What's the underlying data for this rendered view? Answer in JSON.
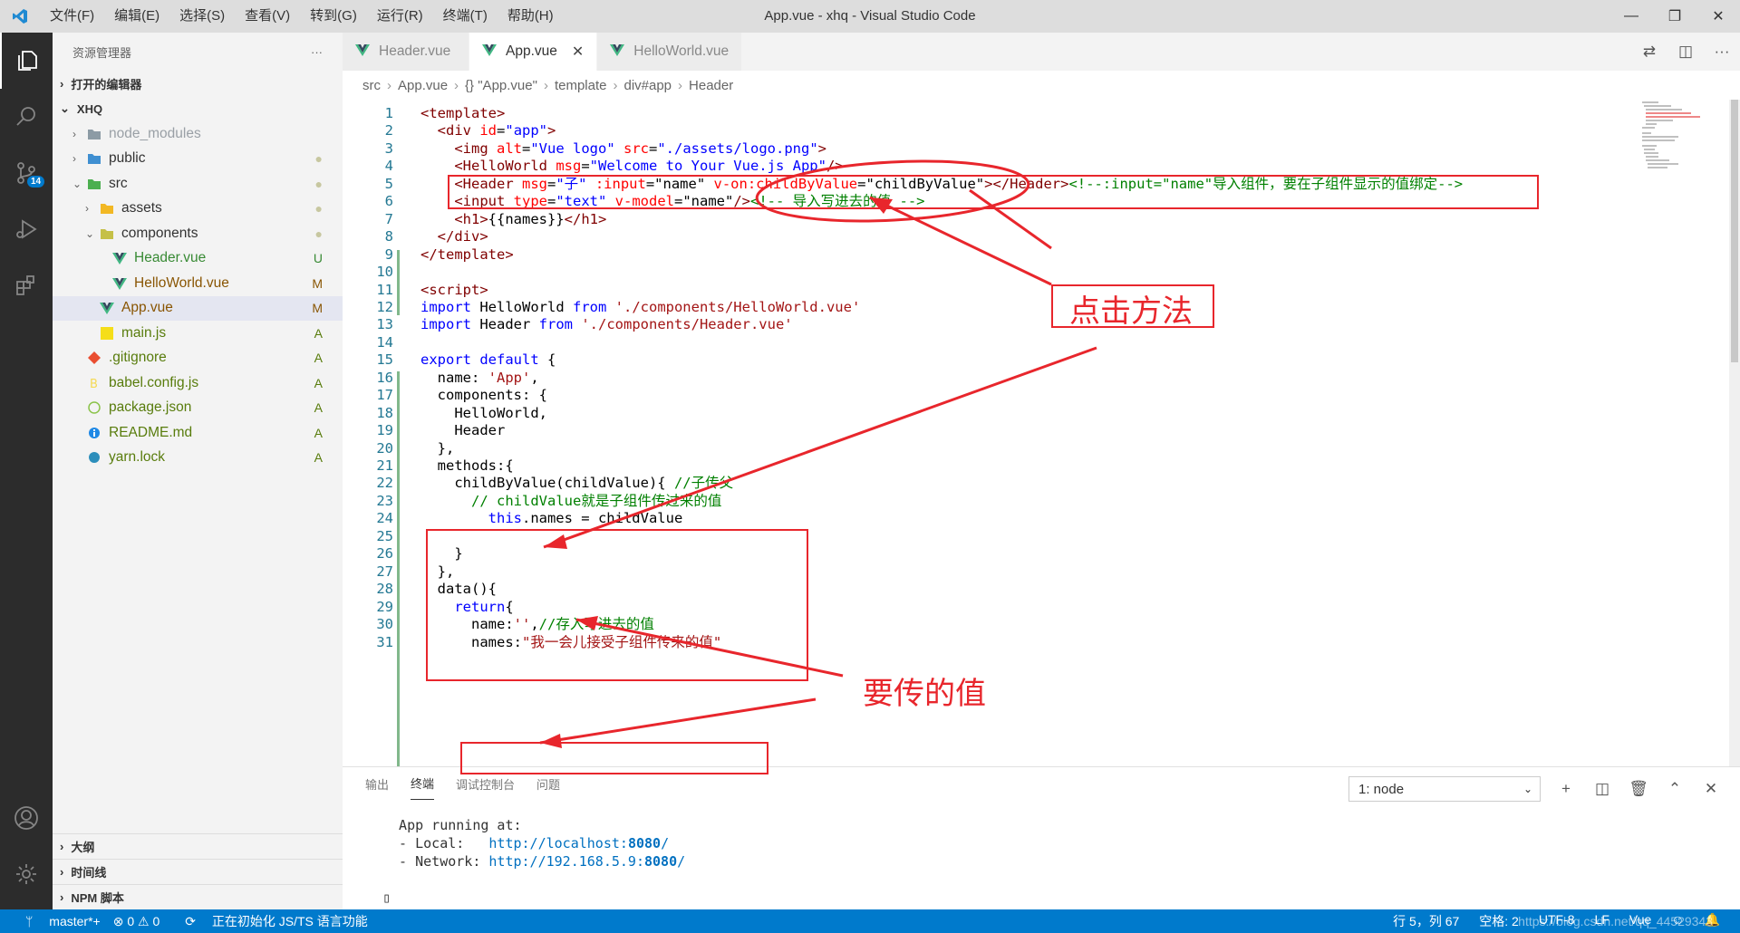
{
  "menu": [
    "文件(F)",
    "编辑(E)",
    "选择(S)",
    "查看(V)",
    "转到(G)",
    "运行(R)",
    "终端(T)",
    "帮助(H)"
  ],
  "window_title": "App.vue - xhq - Visual Studio Code",
  "activity": {
    "scm_badge": "14"
  },
  "sidebar": {
    "title": "资源管理器",
    "more": "···",
    "open_editors": "打开的编辑器",
    "root": "XHQ",
    "items": [
      {
        "label": "node_modules",
        "status": "",
        "depth": 1,
        "chev": "›",
        "icon": "folder",
        "color": "#9aa0a6"
      },
      {
        "label": "public",
        "status": "●",
        "depth": 1,
        "chev": "›",
        "icon": "folder-blue",
        "color": "#333"
      },
      {
        "label": "src",
        "status": "●",
        "depth": 1,
        "chev": "⌄",
        "icon": "folder-green",
        "color": "#333"
      },
      {
        "label": "assets",
        "status": "●",
        "depth": 2,
        "chev": "›",
        "icon": "folder-yellow",
        "color": "#333"
      },
      {
        "label": "components",
        "status": "●",
        "depth": 2,
        "chev": "⌄",
        "icon": "folder-open",
        "color": "#333"
      },
      {
        "label": "Header.vue",
        "status": "U",
        "depth": 3,
        "chev": "",
        "icon": "vue",
        "color": "#388a34"
      },
      {
        "label": "HelloWorld.vue",
        "status": "M",
        "depth": 3,
        "chev": "",
        "icon": "vue",
        "color": "#895503"
      },
      {
        "label": "App.vue",
        "status": "M",
        "depth": 2,
        "chev": "",
        "icon": "vue",
        "color": "#895503"
      },
      {
        "label": "main.js",
        "status": "A",
        "depth": 2,
        "chev": "",
        "icon": "js",
        "color": "#587c0c"
      },
      {
        "label": ".gitignore",
        "status": "A",
        "depth": 1,
        "chev": "",
        "icon": "git",
        "color": "#587c0c"
      },
      {
        "label": "babel.config.js",
        "status": "A",
        "depth": 1,
        "chev": "",
        "icon": "babel",
        "color": "#587c0c"
      },
      {
        "label": "package.json",
        "status": "A",
        "depth": 1,
        "chev": "",
        "icon": "npm",
        "color": "#587c0c"
      },
      {
        "label": "README.md",
        "status": "A",
        "depth": 1,
        "chev": "",
        "icon": "info",
        "color": "#587c0c"
      },
      {
        "label": "yarn.lock",
        "status": "A",
        "depth": 1,
        "chev": "",
        "icon": "yarn",
        "color": "#587c0c"
      }
    ],
    "bottom_sections": [
      "大纲",
      "时间线",
      "NPM 脚本"
    ]
  },
  "tabs": [
    {
      "label": "Header.vue",
      "active": false
    },
    {
      "label": "App.vue",
      "active": true,
      "close": "✕"
    },
    {
      "label": "HelloWorld.vue",
      "active": false
    }
  ],
  "breadcrumbs": [
    "src",
    "App.vue",
    "{} \"App.vue\"",
    "template",
    "div#app",
    "Header"
  ],
  "code_lines": [
    [
      [
        "t",
        "<template>"
      ]
    ],
    [
      [
        "p",
        "  "
      ],
      [
        "t",
        "<div "
      ],
      [
        "a",
        "id"
      ],
      [
        "p",
        "="
      ],
      [
        "s",
        "\"app\""
      ],
      [
        "t",
        ">"
      ]
    ],
    [
      [
        "p",
        "    "
      ],
      [
        "t",
        "<img "
      ],
      [
        "a",
        "alt"
      ],
      [
        "p",
        "="
      ],
      [
        "s",
        "\"Vue logo\" "
      ],
      [
        "a",
        "src"
      ],
      [
        "p",
        "="
      ],
      [
        "s",
        "\"./assets/logo.png\""
      ],
      [
        "t",
        ">"
      ]
    ],
    [
      [
        "p",
        "    "
      ],
      [
        "t",
        "<HelloWorld "
      ],
      [
        "a",
        "msg"
      ],
      [
        "p",
        "="
      ],
      [
        "s",
        "\"Welcome to Your Vue.js App\""
      ],
      [
        "t",
        "/>"
      ]
    ],
    [
      [
        "p",
        "    "
      ],
      [
        "t",
        "<Header "
      ],
      [
        "a",
        "msg"
      ],
      [
        "p",
        "="
      ],
      [
        "s",
        "\"子\" "
      ],
      [
        "a",
        ":input"
      ],
      [
        "p",
        "="
      ],
      [
        "p",
        "\"name\" "
      ],
      [
        "a",
        "v-on:childByValue"
      ],
      [
        "p",
        "="
      ],
      [
        "p",
        "\"childByValue\""
      ],
      [
        "t",
        "></Header>"
      ],
      [
        "c",
        "<!--:input=\"name\"导入组件，要在子组件显示的值绑定-->"
      ]
    ],
    [
      [
        "p",
        "    "
      ],
      [
        "t",
        "<input "
      ],
      [
        "a",
        "type"
      ],
      [
        "p",
        "="
      ],
      [
        "s",
        "\"text\" "
      ],
      [
        "a",
        "v-model"
      ],
      [
        "p",
        "="
      ],
      [
        "p",
        "\"name\""
      ],
      [
        "t",
        "/>"
      ],
      [
        "c",
        "<!-- 导入写进去的值 -->"
      ]
    ],
    [
      [
        "p",
        "    "
      ],
      [
        "t",
        "<h1>"
      ],
      [
        "p",
        "{{names}}"
      ],
      [
        "t",
        "</h1>"
      ]
    ],
    [
      [
        "p",
        "  "
      ],
      [
        "t",
        "</div>"
      ]
    ],
    [
      [
        "t",
        "</template>"
      ]
    ],
    [],
    [
      [
        "t",
        "<script>"
      ]
    ],
    [
      [
        "k",
        "import "
      ],
      [
        "p",
        "HelloWorld "
      ],
      [
        "k",
        "from "
      ],
      [
        "st",
        "'./components/HelloWorld.vue'"
      ]
    ],
    [
      [
        "k",
        "import "
      ],
      [
        "p",
        "Header "
      ],
      [
        "k",
        "from "
      ],
      [
        "st",
        "'./components/Header.vue'"
      ]
    ],
    [],
    [
      [
        "k",
        "export default "
      ],
      [
        "p",
        "{"
      ]
    ],
    [
      [
        "p",
        "  name: "
      ],
      [
        "st",
        "'App'"
      ],
      [
        "p",
        ","
      ]
    ],
    [
      [
        "p",
        "  components: {"
      ]
    ],
    [
      [
        "p",
        "    HelloWorld,"
      ]
    ],
    [
      [
        "p",
        "    Header"
      ]
    ],
    [
      [
        "p",
        "  },"
      ]
    ],
    [
      [
        "p",
        "  methods:{"
      ]
    ],
    [
      [
        "p",
        "    childByValue(childValue){ "
      ],
      [
        "c",
        "//子传父"
      ]
    ],
    [
      [
        "p",
        "      "
      ],
      [
        "c",
        "// childValue就是子组件传过来的值"
      ]
    ],
    [
      [
        "p",
        "        "
      ],
      [
        "k",
        "this"
      ],
      [
        "p",
        ".names = childValue"
      ]
    ],
    [],
    [
      [
        "p",
        "    }"
      ]
    ],
    [
      [
        "p",
        "  },"
      ]
    ],
    [
      [
        "p",
        "  data(){"
      ]
    ],
    [
      [
        "p",
        "    "
      ],
      [
        "k",
        "return"
      ],
      [
        "p",
        "{"
      ]
    ],
    [
      [
        "p",
        "      name:"
      ],
      [
        "st",
        "''"
      ],
      [
        "p",
        ","
      ],
      [
        "c",
        "//存入写进去的值"
      ]
    ],
    [
      [
        "p",
        "      names:"
      ],
      [
        "st",
        "\"我一会儿接受子组件传来的值\""
      ]
    ]
  ],
  "panel": {
    "tabs": [
      "输出",
      "终端",
      "调试控制台",
      "问题"
    ],
    "active_tab": "终端",
    "select": "1: node",
    "terminal": {
      "l1": "  App running at:",
      "l2_label": "  - Local:   ",
      "l2_url": "http://localhost:",
      "l2_port": "8080",
      "l2_end": "/",
      "l3_label": "  - Network: ",
      "l3_url": "http://192.168.5.9:",
      "l3_port": "8080",
      "l3_end": "/",
      "cursor": "▯"
    }
  },
  "statusbar": {
    "branch": "master*+",
    "problems": "⊗ 0 ⚠ 0",
    "task": "正在初始化 JS/TS 语言功能",
    "position": "行 5，列 67",
    "spaces": "空格: 2",
    "encoding": "UTF-8",
    "eol": "LF",
    "lang": "Vue",
    "watermark": "https://blog.csdn.net/qq_44529343"
  },
  "annotations": {
    "click_method": "点击方法",
    "value_to_pass": "要传的值"
  },
  "colors": {
    "accent": "#007acc",
    "annotation": "#e8262c"
  }
}
